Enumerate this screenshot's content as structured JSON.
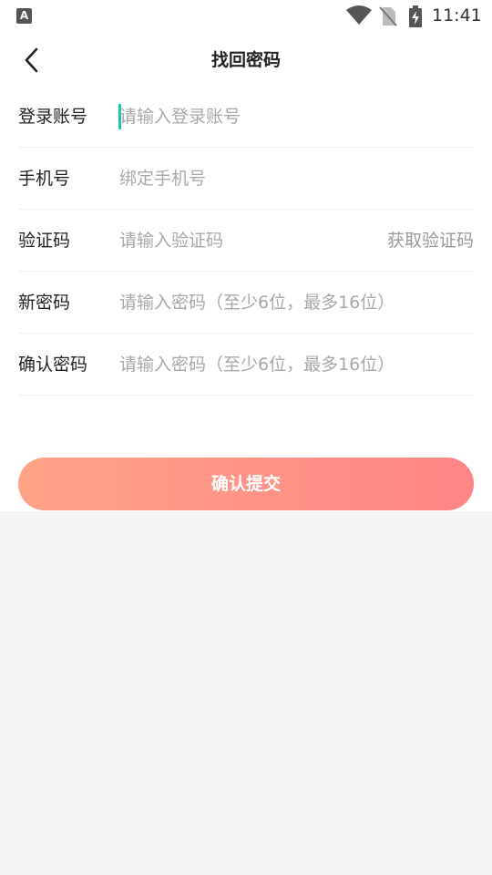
{
  "status_bar": {
    "time": "11:41",
    "notification_icon": "a-app-icon",
    "wifi_icon": "wifi-icon",
    "sim_icon": "no-sim-icon",
    "battery_icon": "battery-charging-icon"
  },
  "header": {
    "title": "找回密码",
    "back_icon": "chevron-left-icon"
  },
  "form": {
    "account": {
      "label": "登录账号",
      "placeholder": "请输入登录账号",
      "value": ""
    },
    "phone": {
      "label": "手机号",
      "placeholder": "绑定手机号",
      "value": ""
    },
    "code": {
      "label": "验证码",
      "placeholder": "请输入验证码",
      "value": "",
      "action_label": "获取验证码"
    },
    "new_password": {
      "label": "新密码",
      "placeholder": "请输入密码（至少6位，最多16位）",
      "value": ""
    },
    "confirm_password": {
      "label": "确认密码",
      "placeholder": "请输入密码（至少6位，最多16位）",
      "value": ""
    }
  },
  "submit": {
    "label": "确认提交"
  },
  "colors": {
    "accent_cursor": "#1fc4b6",
    "button_gradient_start": "#ffa388",
    "button_gradient_end": "#ff8585",
    "page_background": "#f4f4f4"
  }
}
